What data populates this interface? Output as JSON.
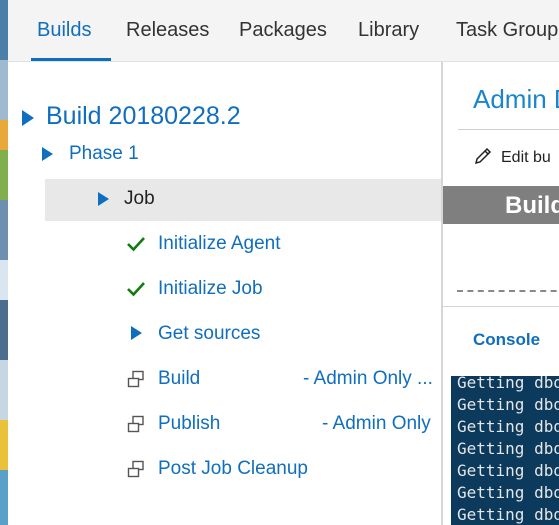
{
  "tabs": [
    {
      "label": "Builds",
      "active": true
    },
    {
      "label": "Releases",
      "active": false
    },
    {
      "label": "Packages",
      "active": false
    },
    {
      "label": "Library",
      "active": false
    },
    {
      "label": "Task Group",
      "active": false
    }
  ],
  "tree": {
    "build": "Build 20180228.2",
    "phase": "Phase 1",
    "job": "Job",
    "steps": [
      {
        "label": "Initialize Agent",
        "status": "succeeded",
        "icon": "check-icon",
        "note": ""
      },
      {
        "label": "Initialize Job",
        "status": "succeeded",
        "icon": "check-icon",
        "note": ""
      },
      {
        "label": "Get sources",
        "status": "collapsed",
        "icon": "triangle-right-icon",
        "note": ""
      },
      {
        "label": "Build",
        "status": "pending",
        "icon": "dependency-icon",
        "note": "- Admin Only ..."
      },
      {
        "label": "Publish",
        "status": "pending",
        "icon": "dependency-icon",
        "note": "- Admin Only"
      },
      {
        "label": "Post Job Cleanup",
        "status": "pending",
        "icon": "dependency-icon",
        "note": ""
      }
    ]
  },
  "right": {
    "title": "Admin D",
    "edit_label": "Edit bu",
    "banner_label": "Build",
    "console_tab": "Console",
    "console_lines": [
      "Getting dbd",
      "Getting dbd",
      "Getting dbd",
      "Getting dbd",
      "Getting dbd",
      "Getting dbd",
      "Getting dbd"
    ]
  },
  "colors": {
    "accent": "#106ebe",
    "success": "#107c10",
    "console_bg": "#0b3a5c"
  }
}
